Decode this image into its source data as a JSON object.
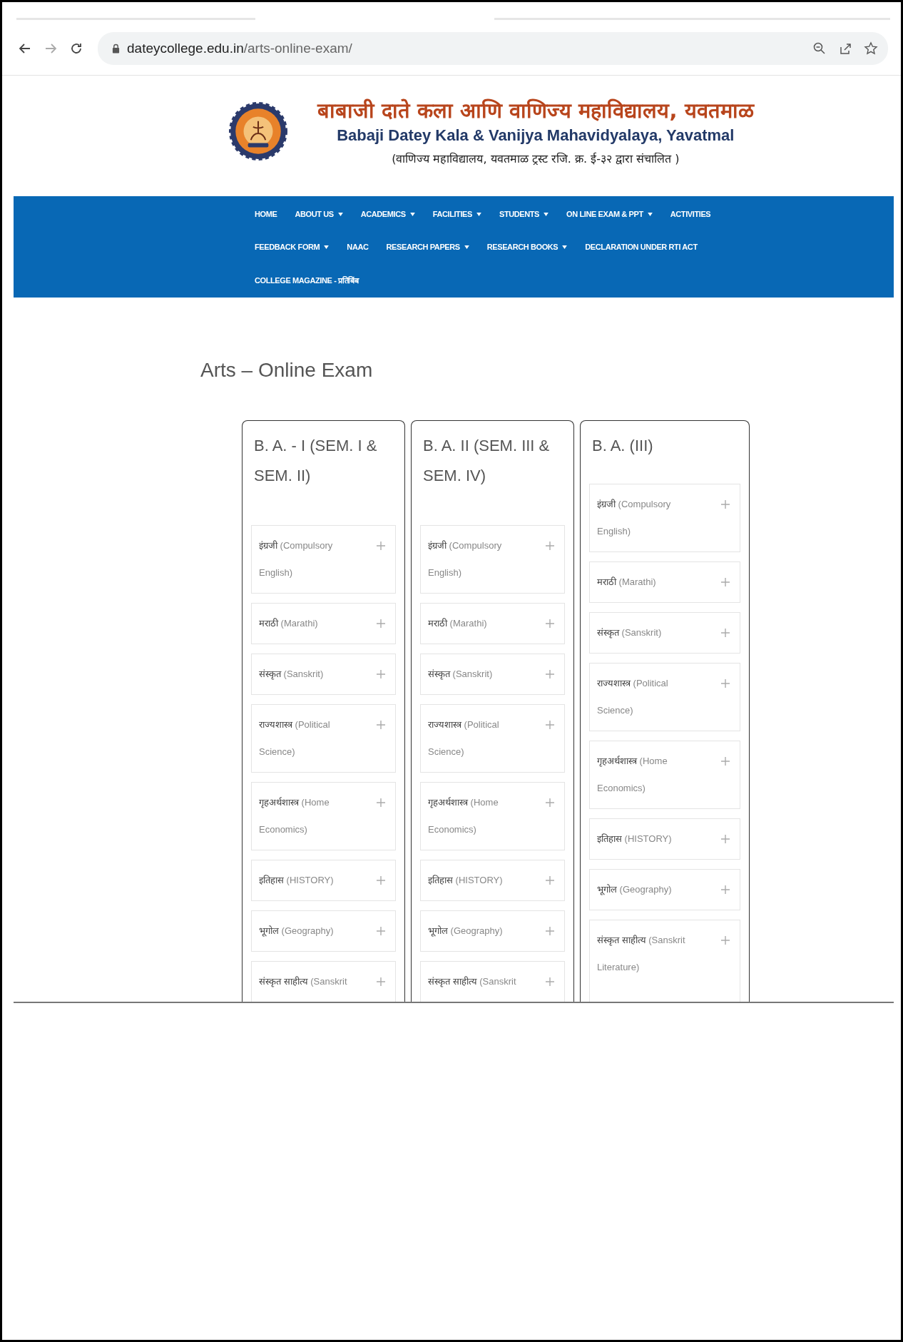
{
  "browser": {
    "url_host": "dateycollege.edu.in",
    "url_path": "/arts-online-exam/"
  },
  "header": {
    "title_marathi": "बाबाजी दाते कला आणि वाणिज्य महाविद्यालय, यवतमाळ",
    "title_english": "Babaji Datey Kala & Vanijya Mahavidyalaya, Yavatmal",
    "subtitle": "(वाणिज्य महाविद्यालय, यवतमाळ ट्रस्ट रजि. क्र. ई-३२ द्वारा संचालित )"
  },
  "nav": [
    [
      {
        "label": "HOME",
        "dropdown": false
      },
      {
        "label": "ABOUT US",
        "dropdown": true
      },
      {
        "label": "ACADEMICS",
        "dropdown": true
      },
      {
        "label": "FACILITIES",
        "dropdown": true
      },
      {
        "label": "STUDENTS",
        "dropdown": true
      },
      {
        "label": "ON LINE EXAM & PPT",
        "dropdown": true
      },
      {
        "label": "ACTIVITIES",
        "dropdown": false
      }
    ],
    [
      {
        "label": "FEEDBACK FORM",
        "dropdown": true
      },
      {
        "label": "NAAC",
        "dropdown": false
      },
      {
        "label": "RESEARCH PAPERS",
        "dropdown": true
      },
      {
        "label": "RESEARCH BOOKS",
        "dropdown": true
      },
      {
        "label": "DECLARATION UNDER RTI ACT",
        "dropdown": false
      }
    ],
    [
      {
        "label": "COLLEGE MAGAZINE - प्रतिबिंब",
        "dropdown": false
      }
    ]
  ],
  "page_title": "Arts – Online Exam",
  "columns": [
    {
      "title": "B. A. - I (SEM. I & SEM. II)",
      "items": [
        {
          "name_mr": "इंग्रजी",
          "name_en": "(Compulsory English)",
          "expanded": false
        },
        {
          "name_mr": "मराठी",
          "name_en": "(Marathi)",
          "expanded": false
        },
        {
          "name_mr": "संस्कृत",
          "name_en": "(Sanskrit)",
          "expanded": false
        },
        {
          "name_mr": "राज्यशास्त्र",
          "name_en": "(Political Science)",
          "expanded": false
        },
        {
          "name_mr": "गृहअर्थशास्त्र",
          "name_en": "(Home Economics)",
          "expanded": false
        },
        {
          "name_mr": "इतिहास",
          "name_en": "(HISTORY)",
          "expanded": false
        },
        {
          "name_mr": "भूगोल",
          "name_en": "(Geography)",
          "expanded": false
        },
        {
          "name_mr": "संस्कृत साहीत्य",
          "name_en": "(Sanskrit",
          "expanded": false
        }
      ]
    },
    {
      "title": "B. A. II (SEM. III & SEM. IV)",
      "items": [
        {
          "name_mr": "इंग्रजी",
          "name_en": "(Compulsory English)",
          "expanded": false
        },
        {
          "name_mr": "मराठी",
          "name_en": "(Marathi)",
          "expanded": false
        },
        {
          "name_mr": "संस्कृत",
          "name_en": "(Sanskrit)",
          "expanded": false
        },
        {
          "name_mr": "राज्यशास्त्र",
          "name_en": "(Political Science)",
          "expanded": false
        },
        {
          "name_mr": "गृहअर्थशास्त्र",
          "name_en": "(Home Economics)",
          "expanded": false
        },
        {
          "name_mr": "इतिहास",
          "name_en": "(HISTORY)",
          "expanded": false
        },
        {
          "name_mr": "भूगोल",
          "name_en": "(Geography)",
          "expanded": false
        },
        {
          "name_mr": "संस्कृत साहीत्य",
          "name_en": "(Sanskrit",
          "expanded": false
        }
      ]
    },
    {
      "title": "B. A. (III)",
      "items": [
        {
          "name_mr": "इंग्रजी",
          "name_en": "(Compulsory English)",
          "expanded": false
        },
        {
          "name_mr": "मराठी",
          "name_en": "(Marathi)",
          "expanded": false
        },
        {
          "name_mr": "संस्कृत",
          "name_en": "(Sanskrit)",
          "expanded": false
        },
        {
          "name_mr": "राज्यशास्त्र",
          "name_en": "(Political Science)",
          "expanded": false
        },
        {
          "name_mr": "गृहअर्थशास्त्र",
          "name_en": "(Home Economics)",
          "expanded": false
        },
        {
          "name_mr": "इतिहास",
          "name_en": "(HISTORY)",
          "expanded": false
        },
        {
          "name_mr": "भूगोल",
          "name_en": "(Geography)",
          "expanded": false
        },
        {
          "name_mr": "संस्कृत साहीत्य",
          "name_en": "(Sanskrit Literature)",
          "expanded": false
        }
      ]
    }
  ]
}
